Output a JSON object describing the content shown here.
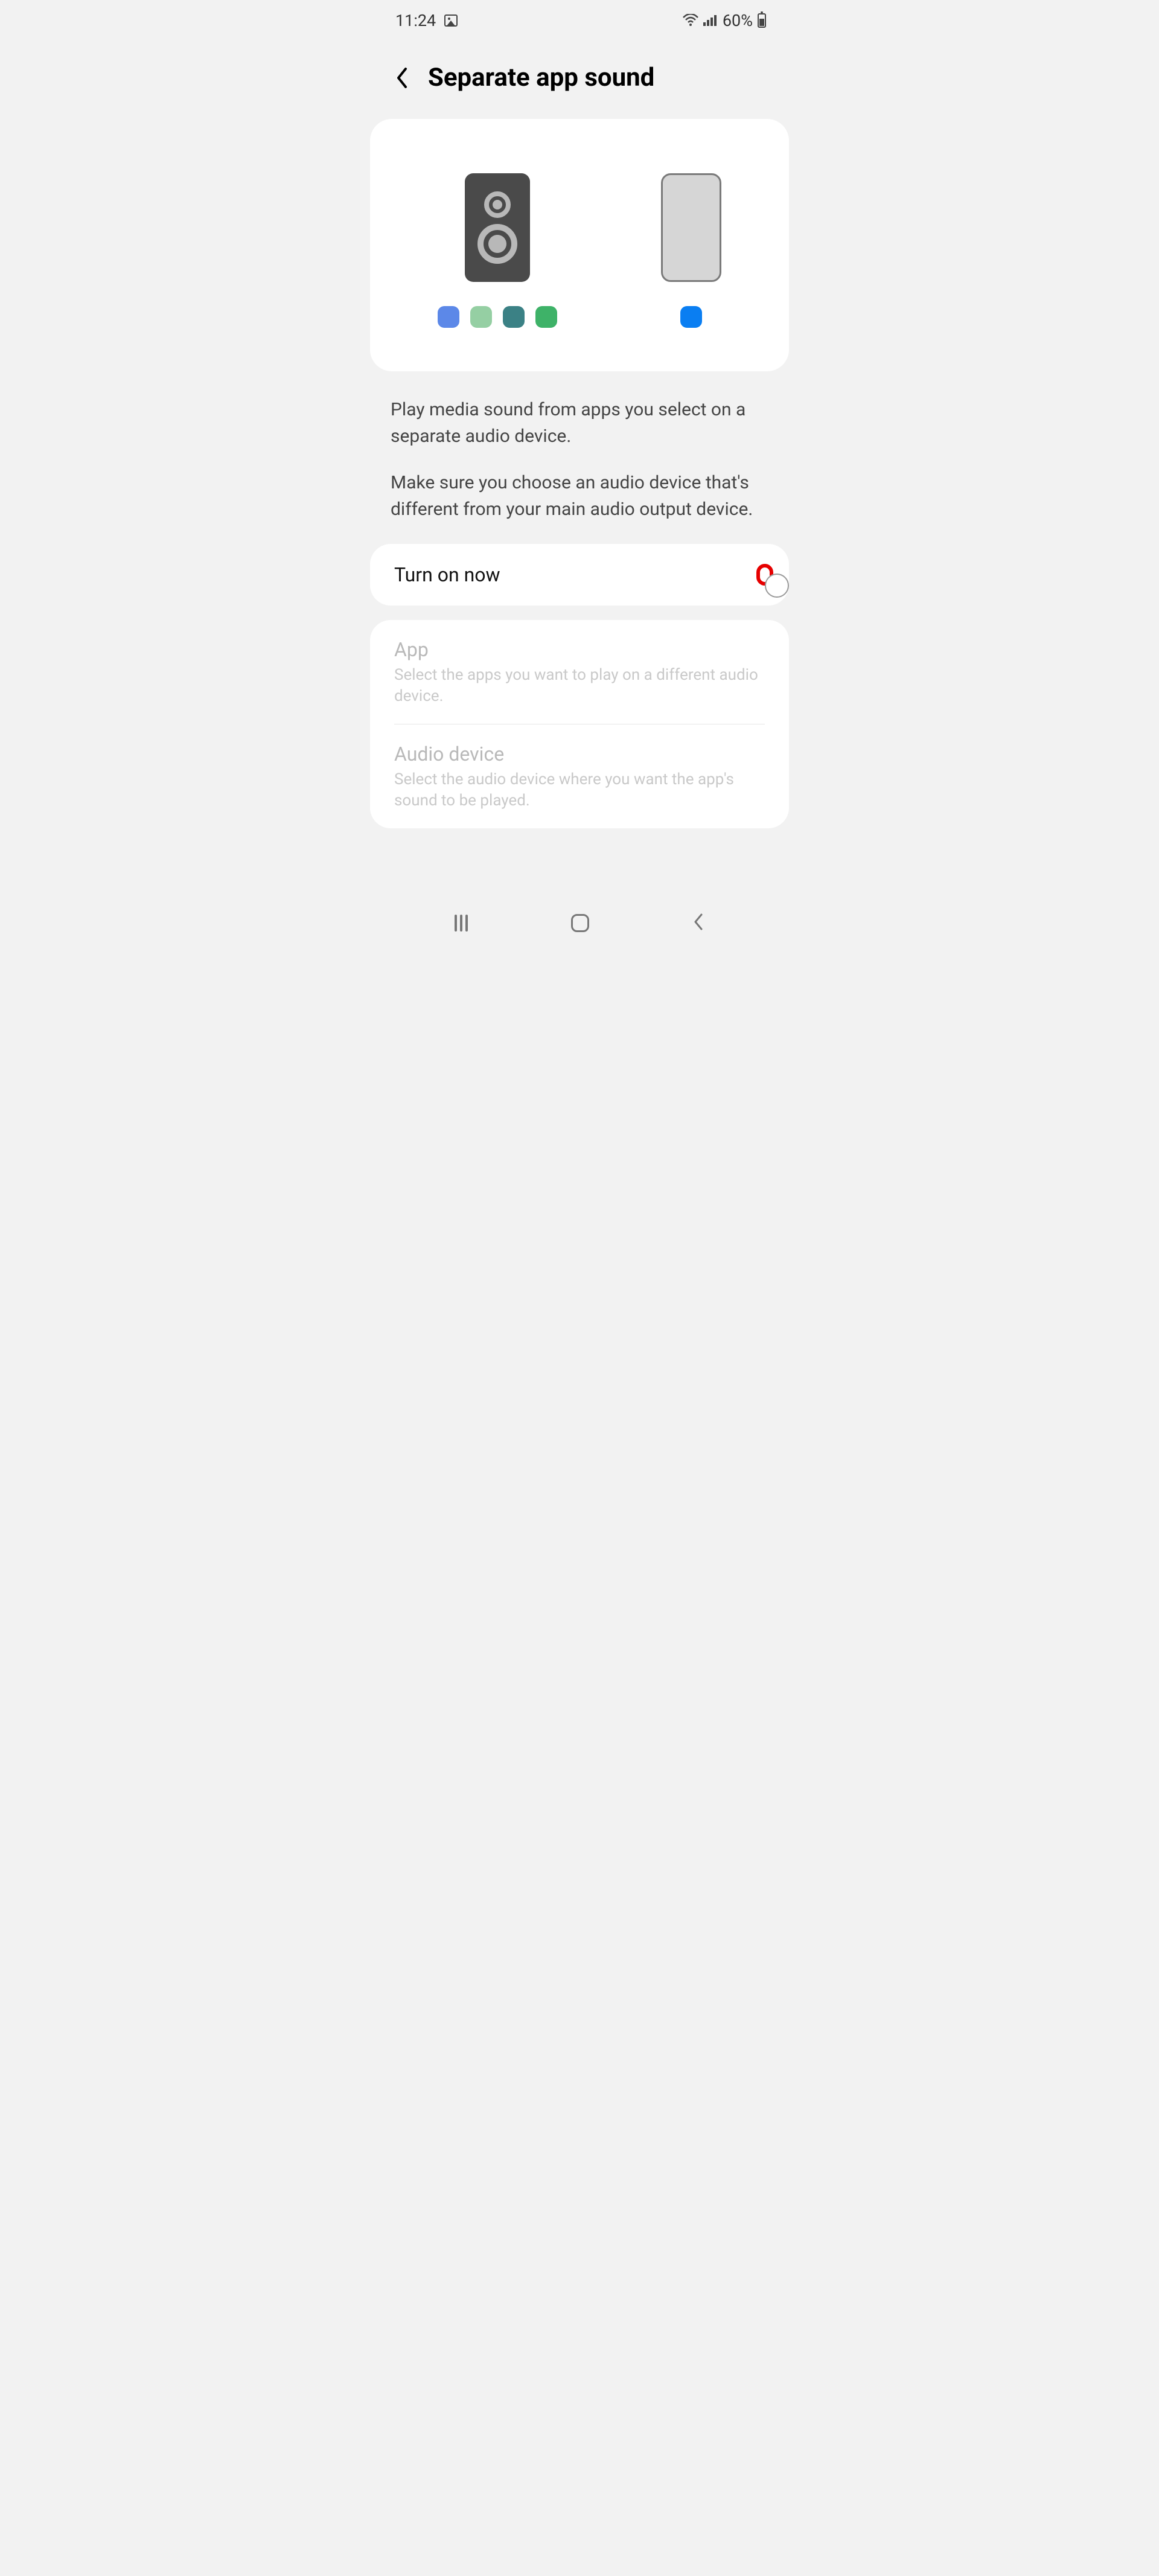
{
  "statusbar": {
    "time": "11:24",
    "battery_text": "60%"
  },
  "header": {
    "title": "Separate app sound"
  },
  "illustration": {
    "speaker_dots": [
      "blue",
      "mint",
      "teal",
      "green"
    ],
    "phone_dots": [
      "phoneblue"
    ]
  },
  "description": {
    "p1": "Play media sound from apps you select on a separate audio device.",
    "p2": "Make sure you choose an audio device that's different from your main audio output device."
  },
  "toggle": {
    "label": "Turn on now",
    "state": "off"
  },
  "options": {
    "app": {
      "title": "App",
      "subtitle": "Select the apps you want to play on a different audio device."
    },
    "audio_device": {
      "title": "Audio device",
      "subtitle": "Select the audio device where you want the app's sound to be played."
    }
  }
}
